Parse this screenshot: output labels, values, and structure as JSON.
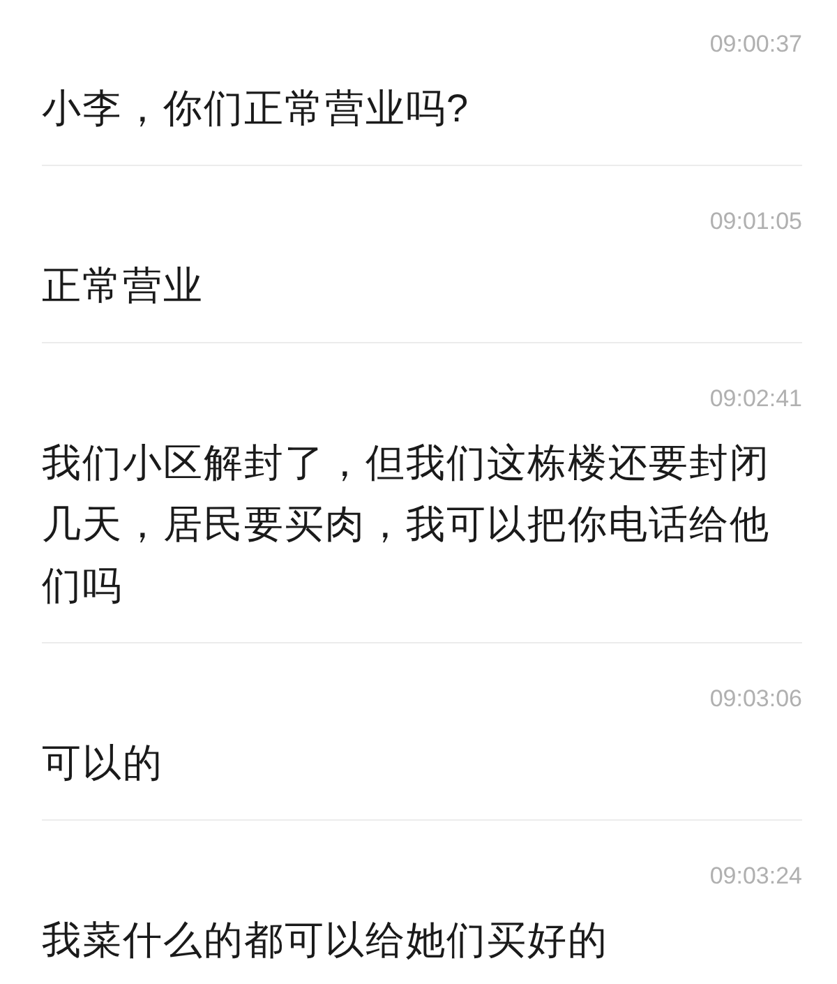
{
  "messages": [
    {
      "time": "09:00:37",
      "text": "小李，你们正常营业吗?"
    },
    {
      "time": "09:01:05",
      "text": "正常营业"
    },
    {
      "time": "09:02:41",
      "text": "我们小区解封了，但我们这栋楼还要封闭几天，居民要买肉，我可以把你电话给他们吗"
    },
    {
      "time": "09:03:06",
      "text": "可以的"
    },
    {
      "time": "09:03:24",
      "text": "我菜什么的都可以给她们买好的"
    }
  ]
}
